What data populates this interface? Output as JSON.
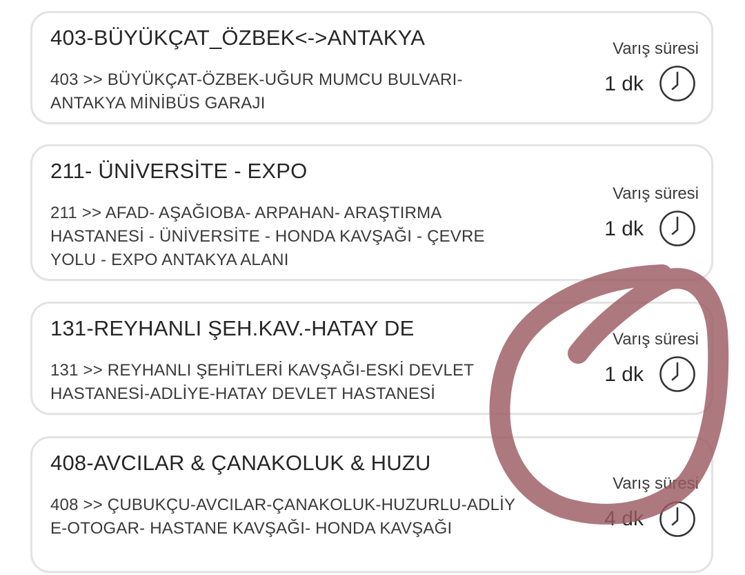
{
  "eta_label": "Varış süresi",
  "icons": {
    "clock": "clock-icon"
  },
  "annotation_color": "#9c5a63",
  "routes": [
    {
      "title": "403-BÜYÜKÇAT_ÖZBEK<->ANTAKYA",
      "description": "403 >> BÜYÜKÇAT-ÖZBEK-UĞUR MUMCU BULVARI-ANTAKYA MİNİBÜS GARAJI",
      "eta": "1 dk"
    },
    {
      "title": "211- ÜNİVERSİTE - EXPO",
      "description": "211 >> AFAD- AŞAĞIOBA- ARPAHAN- ARAŞTIRMA HASTANESİ - ÜNİVERSİTE - HONDA KAVŞAĞI - ÇEVRE YOLU - EXPO ANTAKYA ALANI",
      "eta": "1 dk"
    },
    {
      "title": "131-REYHANLI ŞEH.KAV.-HATAY DE",
      "description": "131 >> REYHANLI ŞEHİTLERİ KAVŞAĞI-ESKİ DEVLET HASTANESİ-ADLİYE-HATAY DEVLET HASTANESİ",
      "eta": "1 dk"
    },
    {
      "title": "408-AVCILAR & ÇANAKOLUK & HUZU",
      "description": "408 >> ÇUBUKÇU-AVCILAR-ÇANAKOLUK-HUZURLU-ADLİYE-OTOGAR- HASTANE KAVŞAĞI- HONDA KAVŞAĞI",
      "eta": "4 dk"
    }
  ]
}
